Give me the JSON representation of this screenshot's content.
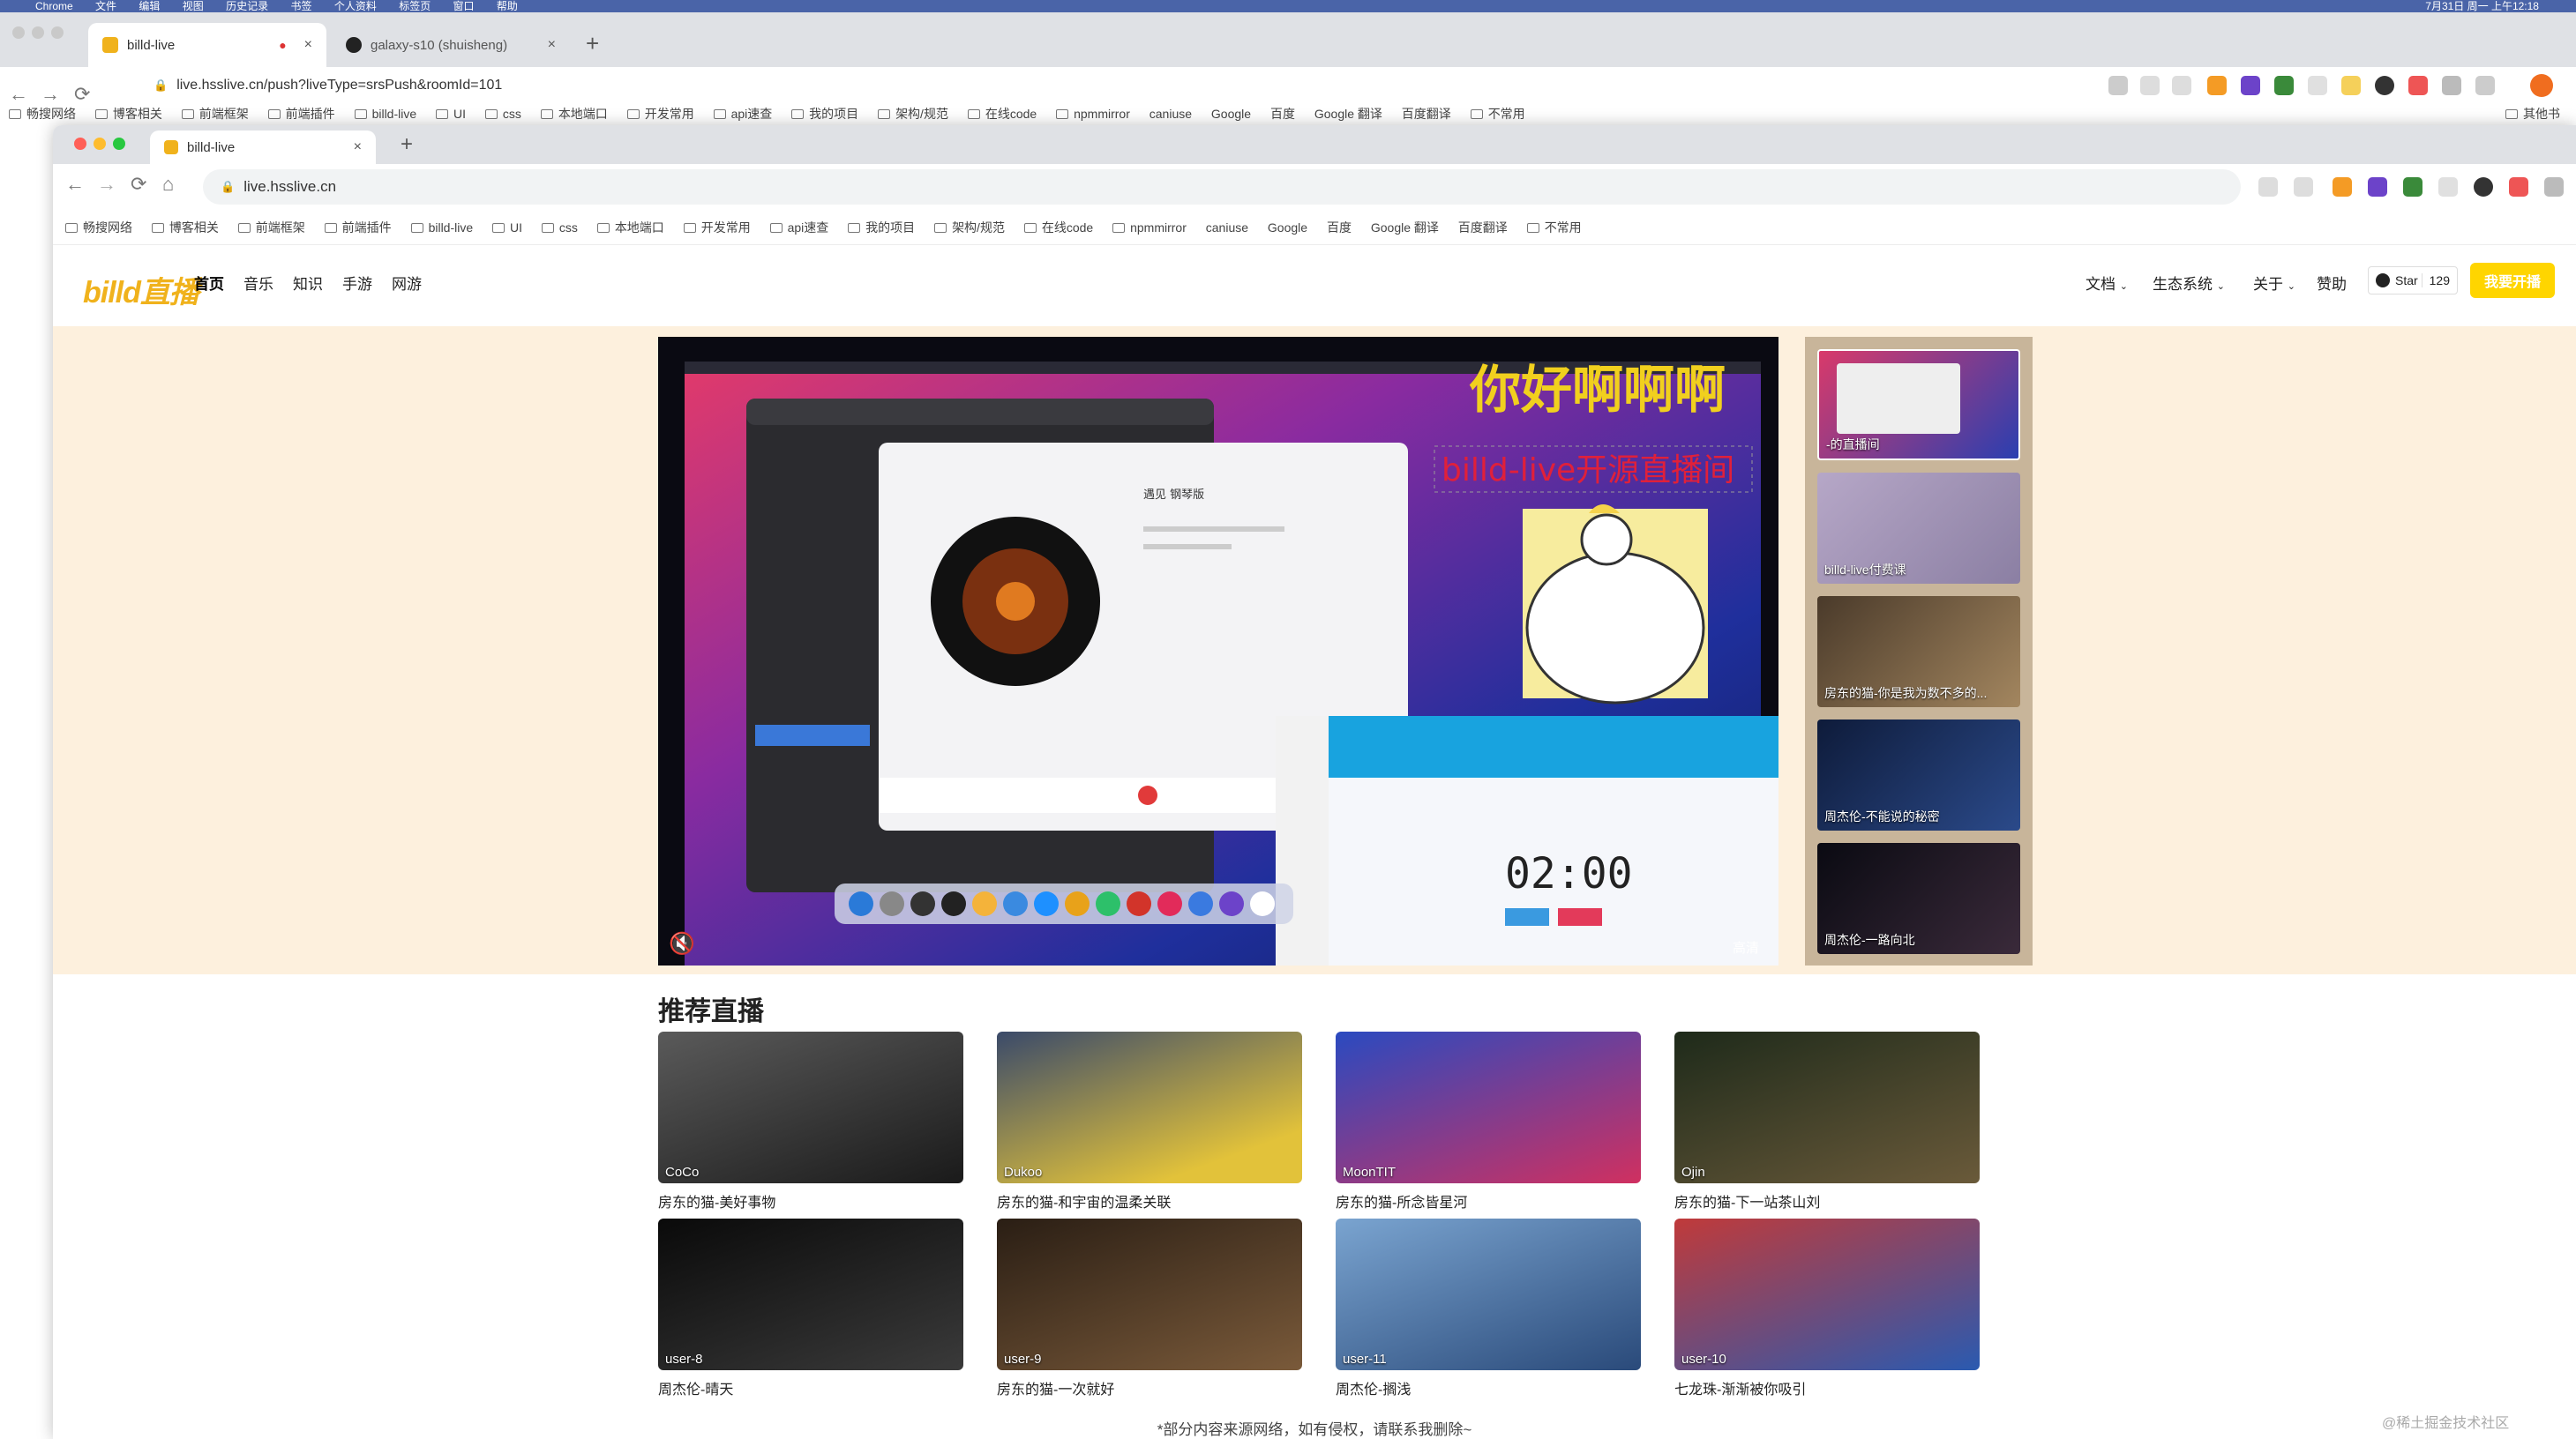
{
  "menubar": {
    "items": [
      "Chrome",
      "文件",
      "编辑",
      "视图",
      "历史记录",
      "书签",
      "个人资料",
      "标签页",
      "窗口",
      "帮助"
    ],
    "right_text": "7月31日 周一 上午12:18"
  },
  "outer_browser": {
    "tabs": [
      {
        "label": "billd-live",
        "active": true
      },
      {
        "label": "galaxy-s10 (shuisheng)",
        "active": false
      }
    ],
    "url": "live.hsslive.cn/push?liveType=srsPush&roomId=101",
    "bookmarks": [
      "畅搜网络",
      "博客相关",
      "前端框架",
      "前端插件",
      "billd-live",
      "UI",
      "css",
      "本地端口",
      "开发常用",
      "api速查",
      "我的项目",
      "架构/规范",
      "在线code",
      "npmmirror",
      "caniuse",
      "Google",
      "百度",
      "Google 翻译",
      "百度翻译",
      "不常用"
    ],
    "bookmarks_right": "其他书"
  },
  "inner_browser": {
    "tab": {
      "label": "billd-live"
    },
    "url": "live.hsslive.cn",
    "bookmarks": [
      "畅搜网络",
      "博客相关",
      "前端框架",
      "前端插件",
      "billd-live",
      "UI",
      "css",
      "本地端口",
      "开发常用",
      "api速查",
      "我的项目",
      "架构/规范",
      "在线code",
      "npmmirror",
      "caniuse",
      "Google",
      "百度",
      "Google 翻译",
      "百度翻译",
      "不常用"
    ]
  },
  "site": {
    "logo": "billd直播",
    "nav": [
      "首页",
      "音乐",
      "知识",
      "手游",
      "网游"
    ],
    "nav_right": [
      "文档",
      "生态系统",
      "关于",
      "赞助"
    ],
    "star_label": "Star",
    "star_count": "129",
    "start_live": "我要开播"
  },
  "player": {
    "overlay_title": "你好啊啊啊",
    "overlay_subtitle": "billd-live开源直播间",
    "song_title": "遇见 钢琴版",
    "timer": "02:00",
    "corner_label": "高清"
  },
  "playlist": [
    {
      "caption": "-的直播间"
    },
    {
      "caption": "billd-live付费课"
    },
    {
      "caption": "房东的猫-你是我为数不多的..."
    },
    {
      "caption": "周杰伦-不能说的秘密"
    },
    {
      "caption": "周杰伦-一路向北"
    }
  ],
  "recommend": {
    "title": "推荐直播",
    "cards": [
      {
        "user": "CoCo",
        "title": "房东的猫-美好事物"
      },
      {
        "user": "Dukoo",
        "title": "房东的猫-和宇宙的温柔关联"
      },
      {
        "user": "MoonTIT",
        "title": "房东的猫-所念皆星河"
      },
      {
        "user": "Ojin",
        "title": "房东的猫-下一站茶山刘"
      },
      {
        "user": "user-8",
        "title": "周杰伦-晴天"
      },
      {
        "user": "user-9",
        "title": "房东的猫-一次就好"
      },
      {
        "user": "user-11",
        "title": "周杰伦-搁浅"
      },
      {
        "user": "user-10",
        "title": "七龙珠-渐渐被你吸引"
      }
    ]
  },
  "footer_note": "*部分内容来源网络，如有侵权，请联系我删除~",
  "watermark": "@稀土掘金技术社区",
  "colors": {
    "brand": "#f0b21c",
    "hero_bg": "#fdf0dd",
    "start_button": "#ffd500"
  }
}
